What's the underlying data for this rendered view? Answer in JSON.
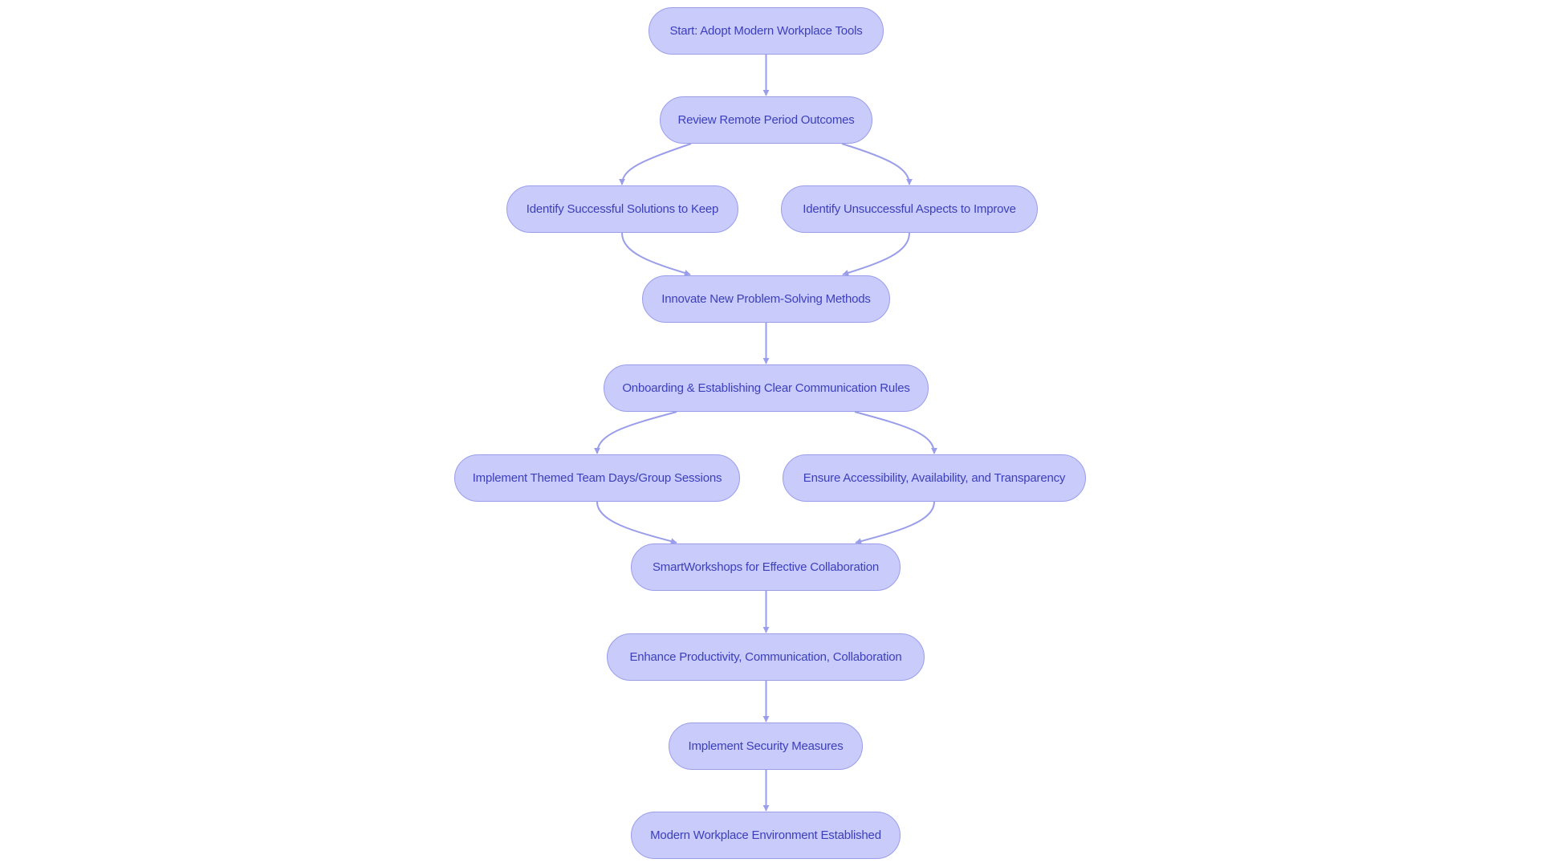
{
  "diagram": {
    "type": "flowchart",
    "direction": "top-to-bottom",
    "colors": {
      "node_fill": "#c9cbfa",
      "node_border": "#9a9eea",
      "node_text": "#3c3fbb",
      "edge": "#9a9eea",
      "background": "#ffffff"
    },
    "nodes": [
      {
        "id": "start",
        "label": "Start: Adopt Modern Workplace Tools"
      },
      {
        "id": "review",
        "label": "Review Remote Period Outcomes"
      },
      {
        "id": "keep",
        "label": "Identify Successful Solutions to Keep"
      },
      {
        "id": "improve",
        "label": "Identify Unsuccessful Aspects to Improve"
      },
      {
        "id": "innovate",
        "label": "Innovate New Problem-Solving Methods"
      },
      {
        "id": "onboarding",
        "label": "Onboarding & Establishing Clear Communication Rules"
      },
      {
        "id": "themed",
        "label": "Implement Themed Team Days/Group Sessions"
      },
      {
        "id": "ensure",
        "label": "Ensure Accessibility, Availability, and Transparency"
      },
      {
        "id": "smart",
        "label": "SmartWorkshops for Effective Collaboration"
      },
      {
        "id": "enhance",
        "label": "Enhance Productivity, Communication, Collaboration"
      },
      {
        "id": "security",
        "label": "Implement Security Measures"
      },
      {
        "id": "modern",
        "label": "Modern Workplace Environment Established"
      }
    ],
    "edges": [
      {
        "from": "start",
        "to": "review"
      },
      {
        "from": "review",
        "to": "keep"
      },
      {
        "from": "review",
        "to": "improve"
      },
      {
        "from": "keep",
        "to": "innovate"
      },
      {
        "from": "improve",
        "to": "innovate"
      },
      {
        "from": "innovate",
        "to": "onboarding"
      },
      {
        "from": "onboarding",
        "to": "themed"
      },
      {
        "from": "onboarding",
        "to": "ensure"
      },
      {
        "from": "themed",
        "to": "smart"
      },
      {
        "from": "ensure",
        "to": "smart"
      },
      {
        "from": "smart",
        "to": "enhance"
      },
      {
        "from": "enhance",
        "to": "security"
      },
      {
        "from": "security",
        "to": "modern"
      }
    ]
  }
}
